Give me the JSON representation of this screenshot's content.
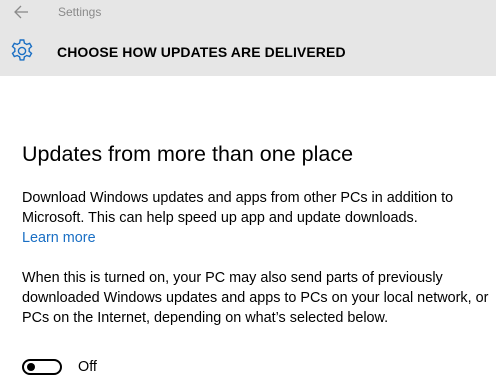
{
  "window": {
    "title": "Settings",
    "back_icon": "arrow-left-icon"
  },
  "header": {
    "icon": "gear-icon",
    "title": "CHOOSE HOW UPDATES ARE DELIVERED"
  },
  "section": {
    "heading": "Updates from more than one place",
    "description": "Download Windows updates and apps from other PCs in addition to Microsoft. This can help speed up app and update downloads.",
    "learn_more": "Learn more",
    "detail": "When this is turned on, your PC may also send parts of previously downloaded Windows updates and apps to PCs on your local network, or PCs on the Internet, depending on what’s selected below."
  },
  "toggle": {
    "state": "Off",
    "on": false
  },
  "colors": {
    "header_bg": "#e6e6e6",
    "accent": "#1a6fc4",
    "title_gray": "#8a8a8a"
  }
}
